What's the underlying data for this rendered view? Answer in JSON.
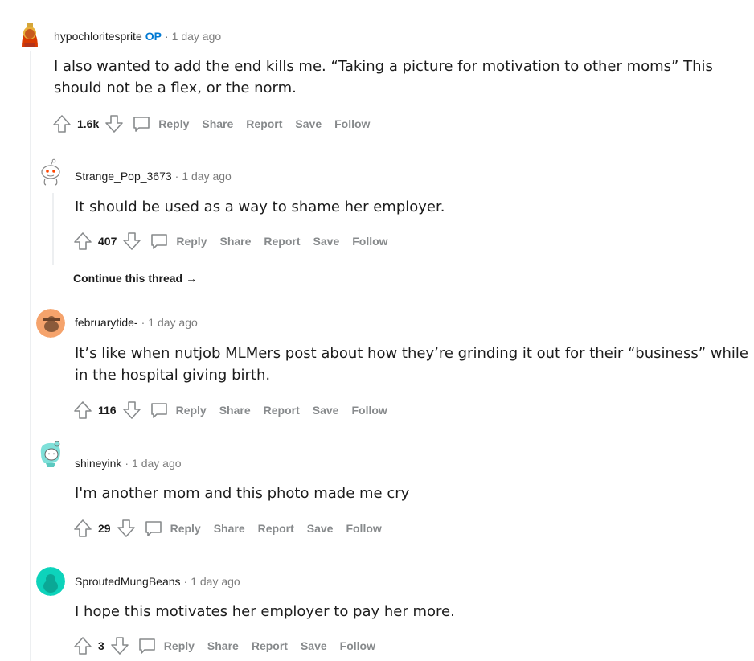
{
  "comments": [
    {
      "username": "hypochloritesprite",
      "op_badge": "OP",
      "time": "1 day ago",
      "text": "I also wanted to add the end kills me. “Taking a picture for motivation to other moms” This should not be a flex, or the norm.",
      "score": "1.6k",
      "actions": {
        "reply": "Reply",
        "share": "Share",
        "report": "Report",
        "save": "Save",
        "follow": "Follow"
      },
      "avatar_color": "#d93a00"
    },
    {
      "username": "Strange_Pop_3673",
      "time": "1 day ago",
      "text": "It should be used as a way to shame her employer.",
      "score": "407",
      "actions": {
        "reply": "Reply",
        "share": "Share",
        "report": "Report",
        "save": "Save",
        "follow": "Follow"
      },
      "continue_label": "Continue this thread",
      "avatar_color": "#ffffff"
    },
    {
      "username": "februarytide-",
      "time": "1 day ago",
      "text": "It’s like when nutjob MLMers post about how they’re grinding it out for their “business” while in the hospital giving birth.",
      "score": "116",
      "actions": {
        "reply": "Reply",
        "share": "Share",
        "report": "Report",
        "save": "Save",
        "follow": "Follow"
      },
      "avatar_color": "#f5a36c"
    },
    {
      "username": "shineyink",
      "time": "1 day ago",
      "text": "I'm another mom and this photo made me cry",
      "score": "29",
      "actions": {
        "reply": "Reply",
        "share": "Share",
        "report": "Report",
        "save": "Save",
        "follow": "Follow"
      },
      "avatar_color": "#7fe0d9"
    },
    {
      "username": "SproutedMungBeans",
      "time": "1 day ago",
      "text": "I hope this motivates her employer to pay her more.",
      "score": "3",
      "actions": {
        "reply": "Reply",
        "share": "Share",
        "report": "Report",
        "save": "Save",
        "follow": "Follow"
      },
      "avatar_color": "#0dd3bb"
    }
  ],
  "separator": "·",
  "icons": {
    "upvote": "upvote-arrow-icon",
    "downvote": "downvote-arrow-icon",
    "reply": "speech-bubble-icon",
    "continue": "right-arrow-icon"
  }
}
